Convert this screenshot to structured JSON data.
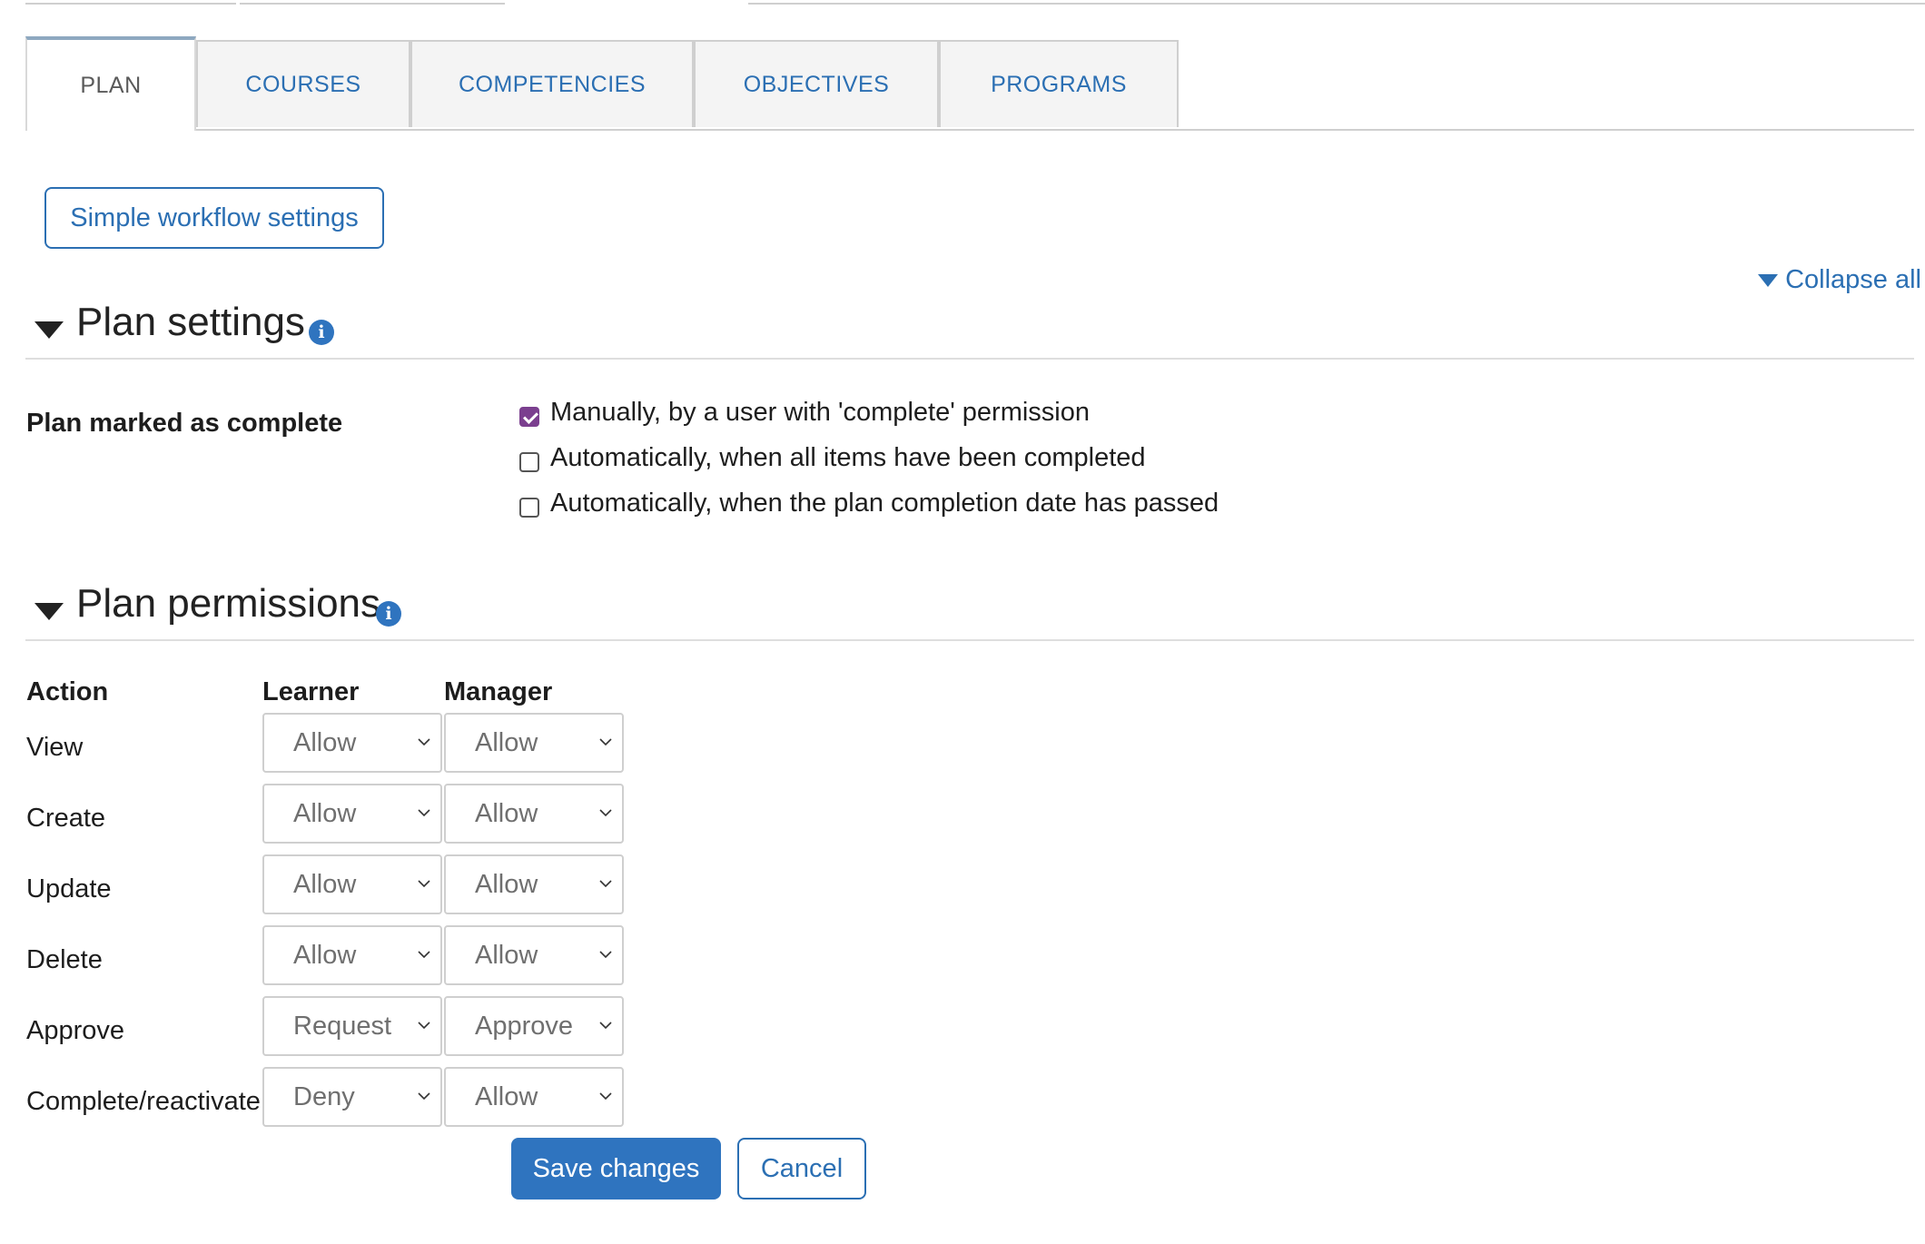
{
  "tabs": [
    {
      "label": "PLAN",
      "active": true
    },
    {
      "label": "COURSES",
      "active": false
    },
    {
      "label": "COMPETENCIES",
      "active": false
    },
    {
      "label": "OBJECTIVES",
      "active": false
    },
    {
      "label": "PROGRAMS",
      "active": false
    }
  ],
  "workflow_button": "Simple workflow settings",
  "collapse_all": "Collapse all",
  "plan_settings": {
    "title": "Plan settings",
    "info_icon": "info-icon",
    "field_label": "Plan marked as complete",
    "options": [
      {
        "label": "Manually, by a user with 'complete' permission",
        "checked": true
      },
      {
        "label": "Automatically, when all items have been completed",
        "checked": false
      },
      {
        "label": "Automatically, when the plan completion date has passed",
        "checked": false
      }
    ]
  },
  "plan_permissions": {
    "title": "Plan permissions",
    "info_icon": "info-icon",
    "headers": {
      "action": "Action",
      "learner": "Learner",
      "manager": "Manager"
    },
    "rows": [
      {
        "action": "View",
        "learner": "Allow",
        "manager": "Allow"
      },
      {
        "action": "Create",
        "learner": "Allow",
        "manager": "Allow"
      },
      {
        "action": "Update",
        "learner": "Allow",
        "manager": "Allow"
      },
      {
        "action": "Delete",
        "learner": "Allow",
        "manager": "Allow"
      },
      {
        "action": "Approve",
        "learner": "Request",
        "manager": "Approve"
      },
      {
        "action": "Complete/reactivate",
        "learner": "Deny",
        "manager": "Allow"
      }
    ]
  },
  "actions": {
    "save": "Save changes",
    "cancel": "Cancel"
  },
  "colors": {
    "accent": "#2f74bf",
    "checkbox_checked": "#7b3f8f"
  }
}
